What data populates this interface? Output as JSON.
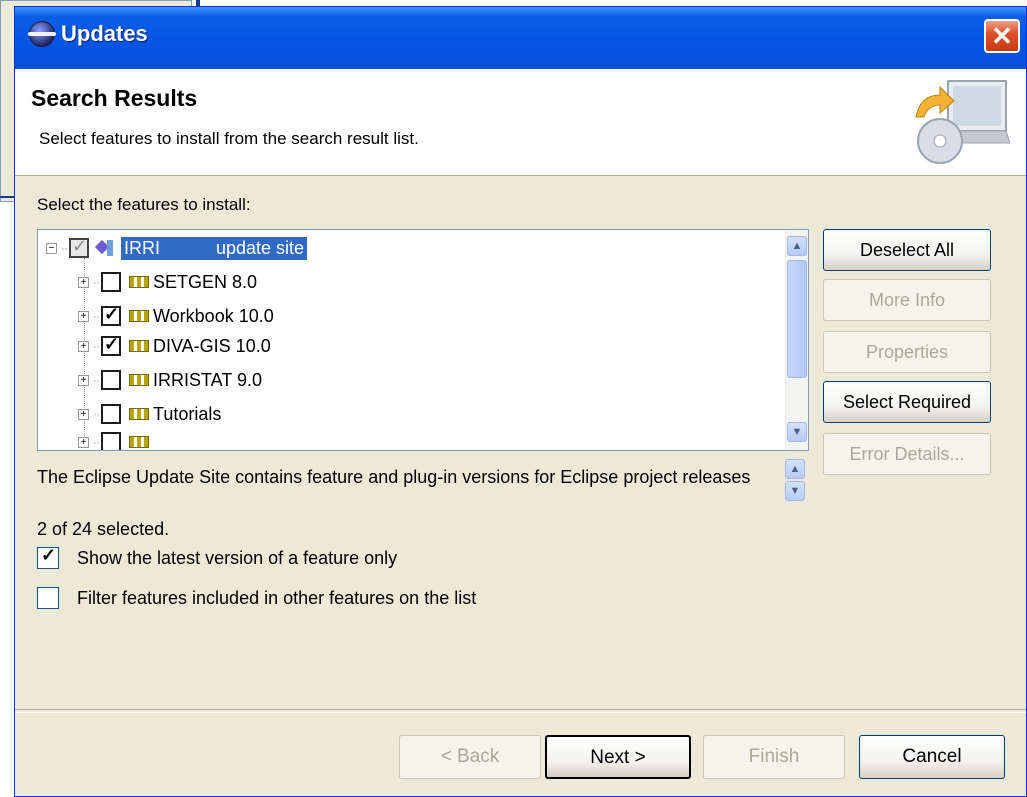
{
  "window": {
    "title": "Updates"
  },
  "header": {
    "title": "Search Results",
    "description": "Select features to install from the search result list."
  },
  "tree_section": {
    "label": "Select the features to install:",
    "root": {
      "label_a": "IRRI",
      "label_b": "update site",
      "state": "partial"
    },
    "items": [
      {
        "label": "SETGEN 8.0",
        "checked": false
      },
      {
        "label": "Workbook 10.0",
        "checked": true
      },
      {
        "label": "DIVA-GIS 10.0",
        "checked": true
      },
      {
        "label": "IRRISTAT 9.0",
        "checked": false
      },
      {
        "label": "Tutorials",
        "checked": false
      },
      {
        "label": "",
        "checked": false
      }
    ]
  },
  "side_buttons": {
    "deselect_all": "Deselect All",
    "more_info": "More Info",
    "properties": "Properties",
    "select_required": "Select Required",
    "error_details": "Error Details..."
  },
  "description_text": "The Eclipse Update Site contains feature and plug-in versions for Eclipse project releases",
  "selection_count": "2 of 24 selected.",
  "options": {
    "latest_only": {
      "label": "Show the latest version of a feature only",
      "checked": true
    },
    "filter_included": {
      "label": "Filter features included in other features on the list",
      "checked": false
    }
  },
  "buttons": {
    "back": "< Back",
    "next": "Next >",
    "finish": "Finish",
    "cancel": "Cancel"
  }
}
